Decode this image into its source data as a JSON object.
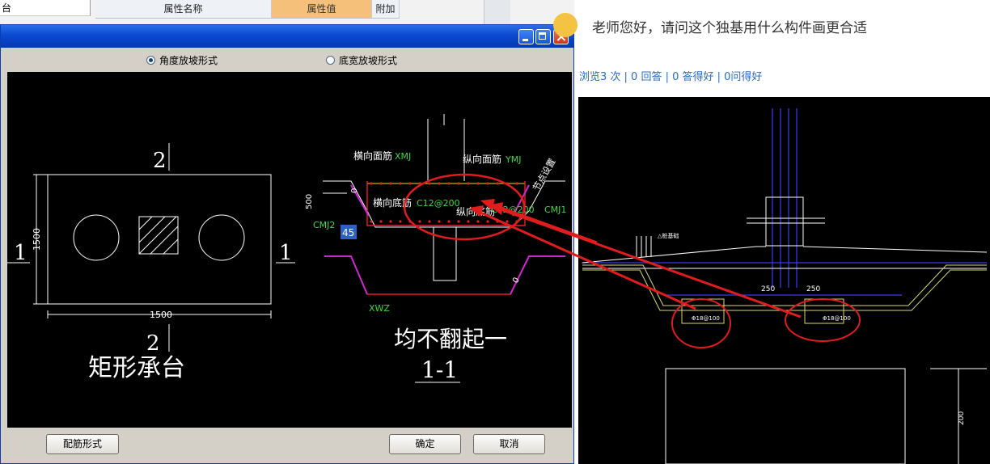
{
  "grid": {
    "left_label": "台",
    "col_name": "属性名称",
    "col_value": "属性值",
    "col_extra": "附加"
  },
  "dialog": {
    "radio_angle": "角度放坡形式",
    "radio_width": "底宽放坡形式",
    "btn_rebar": "配筋形式",
    "btn_ok": "确定",
    "btn_cancel": "取消"
  },
  "drawing": {
    "plan_title": "矩形承台",
    "dim_1500_v": "1500",
    "dim_1500_h": "1500",
    "sec_2_top": "2",
    "sec_2_bot": "2",
    "sec_1_left": "1",
    "sec_1_right": "1",
    "label_xmj_zh": "横向面筋",
    "label_xmj": "XMJ",
    "label_ymj_zh": "纵向面筋",
    "label_ymj": "YMJ",
    "label_xdj_zh": "横向底筋",
    "label_ydj_zh": "纵向底筋",
    "label_rebar1": "C12@200",
    "label_rebar2": "C12@200",
    "label_cmj1": "CMJ1",
    "label_cmj2": "CMJ2",
    "label_jiedian": "节点设置",
    "label_500": "500",
    "label_angle": "45",
    "label_xwz": "XWZ",
    "label_o": "0",
    "note_text": "均不翻起一",
    "section_title": "1-1"
  },
  "qa": {
    "question": "老师您好，请问这个独基用什么构件画更合适",
    "stats": "浏览3 次 | 0 回答 | 0 答得好 | 0问得好",
    "dim_250_a": "250",
    "dim_250_b": "250",
    "dim_200": "200",
    "rebar_a": "Φ18@100",
    "rebar_b": "Φ18@100",
    "label_pile": "△桩基础"
  }
}
